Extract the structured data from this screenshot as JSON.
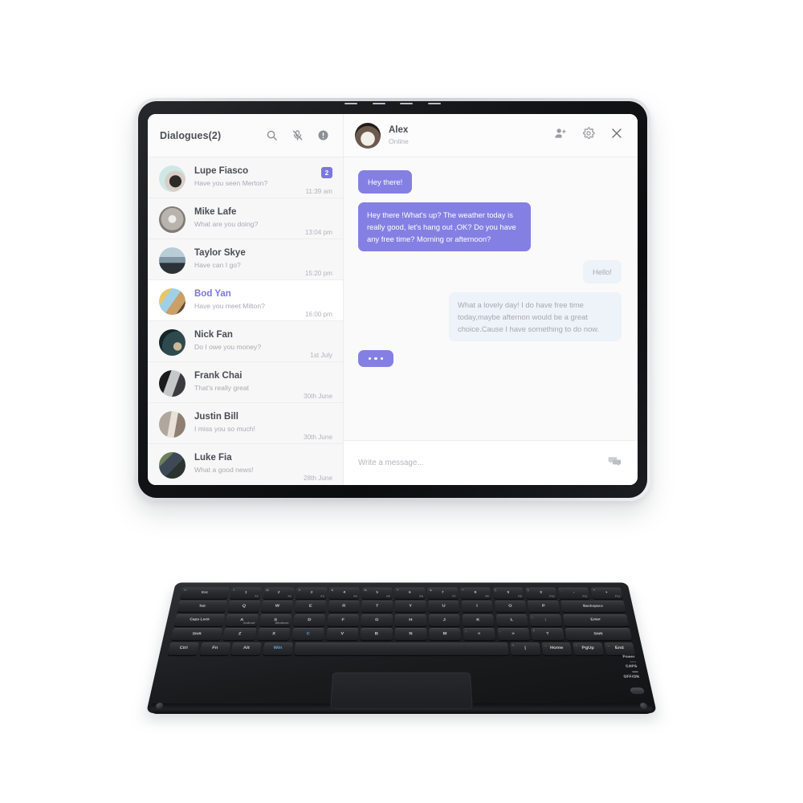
{
  "sidebar": {
    "title": "Dialogues(2)",
    "icons": [
      {
        "name": "search-icon",
        "label": "Search"
      },
      {
        "name": "microphone-muted-icon",
        "label": "Mute"
      },
      {
        "name": "info-icon",
        "label": "Info"
      }
    ],
    "conversations": [
      {
        "name": "Lupe Fiasco",
        "preview": "Have you seen Merton?",
        "time": "11:39  am",
        "badge": "2",
        "active": false
      },
      {
        "name": "Mike Lafe",
        "preview": "What are you doing?",
        "time": "13:04  pm",
        "badge": "",
        "active": false
      },
      {
        "name": "Taylor Skye",
        "preview": "Have can I go?",
        "time": "15:20  pm",
        "badge": "",
        "active": false
      },
      {
        "name": "Bod Yan",
        "preview": "Have you meet Milton?",
        "time": "16:00  pm",
        "badge": "",
        "active": true
      },
      {
        "name": "Nick Fan",
        "preview": "Do I owe you money?",
        "time": "1st  July",
        "badge": "",
        "active": false
      },
      {
        "name": "Frank Chai",
        "preview": "That's really great",
        "time": "30th June",
        "badge": "",
        "active": false
      },
      {
        "name": "Justin Bill",
        "preview": "I miss you so much!",
        "time": "30th June",
        "badge": "",
        "active": false
      },
      {
        "name": "Luke Fia",
        "preview": "What a good news!",
        "time": "28th  June",
        "badge": "",
        "active": false
      }
    ]
  },
  "chat": {
    "peer_name": "Alex",
    "peer_status": "Online",
    "header_icons": [
      {
        "name": "add-person-icon",
        "label": "Add person"
      },
      {
        "name": "gear-icon",
        "label": "Settings"
      },
      {
        "name": "close-icon",
        "label": "Close"
      }
    ],
    "messages": [
      {
        "direction": "in",
        "text": "Hey there!"
      },
      {
        "direction": "in",
        "text": "Hey there !What's up? The weather today is really good, let's hang out ,OK? Do you have any free time? Morning or afternoon?"
      },
      {
        "direction": "out",
        "text": "Hello!"
      },
      {
        "direction": "out",
        "text": "What a lovely day! I do have free time today,maybe afternon would be a great choice.Cause I have something to do now."
      },
      {
        "direction": "in",
        "text": "...",
        "typing": true
      }
    ],
    "composer": {
      "placeholder": "Write a message...",
      "value": "",
      "icon": "chat-bubbles-icon"
    }
  },
  "keyboard": {
    "rows": [
      [
        {
          "main": "Esc",
          "top": "↩",
          "sub": ""
        },
        {
          "main": "1",
          "top": "!",
          "sub": "F1"
        },
        {
          "main": "2",
          "top": "@",
          "sub": "F2"
        },
        {
          "main": "3",
          "top": "#",
          "sub": "F3"
        },
        {
          "main": "4",
          "top": "$",
          "sub": "F4"
        },
        {
          "main": "5",
          "top": "%",
          "sub": "F5"
        },
        {
          "main": "6",
          "top": "^",
          "sub": "F6"
        },
        {
          "main": "7",
          "top": "&",
          "sub": "F7"
        },
        {
          "main": "8",
          "top": "*",
          "sub": "F8"
        },
        {
          "main": "9",
          "top": "(",
          "sub": "F9"
        },
        {
          "main": "0",
          "top": ")",
          "sub": "F10"
        },
        {
          "main": "-",
          "top": "_",
          "sub": "F11"
        },
        {
          "main": "+",
          "top": "=",
          "sub": "F12"
        }
      ],
      [
        {
          "main": "Tab",
          "top": "",
          "sub": ""
        },
        {
          "main": "Q",
          "top": "",
          "sub": ""
        },
        {
          "main": "W",
          "top": "",
          "sub": ""
        },
        {
          "main": "E",
          "top": "",
          "sub": ""
        },
        {
          "main": "R",
          "top": "",
          "sub": ""
        },
        {
          "main": "T",
          "top": "",
          "sub": ""
        },
        {
          "main": "Y",
          "top": "",
          "sub": ""
        },
        {
          "main": "U",
          "top": "",
          "sub": ""
        },
        {
          "main": "I",
          "top": "",
          "sub": ""
        },
        {
          "main": "O",
          "top": "",
          "sub": ""
        },
        {
          "main": "P",
          "top": "",
          "sub": ""
        },
        {
          "main": "Backspace",
          "top": "",
          "sub": ""
        }
      ],
      [
        {
          "main": "Caps Lock",
          "top": "",
          "sub": ""
        },
        {
          "main": "A",
          "top": "",
          "sub": "Android"
        },
        {
          "main": "S",
          "top": "",
          "sub": "Windows"
        },
        {
          "main": "D",
          "top": "",
          "sub": ""
        },
        {
          "main": "F",
          "top": "",
          "sub": ""
        },
        {
          "main": "G",
          "top": "",
          "sub": ""
        },
        {
          "main": "H",
          "top": "",
          "sub": ""
        },
        {
          "main": "J",
          "top": "",
          "sub": ""
        },
        {
          "main": "K",
          "top": "",
          "sub": ""
        },
        {
          "main": "L",
          "top": "",
          "sub": ""
        },
        {
          "main": ":",
          "top": ";",
          "sub": ""
        },
        {
          "main": "Enter",
          "top": "",
          "sub": ""
        }
      ],
      [
        {
          "main": "Shift",
          "top": "",
          "sub": ""
        },
        {
          "main": "Z",
          "top": "",
          "sub": ""
        },
        {
          "main": "X",
          "top": "",
          "sub": ""
        },
        {
          "main": "C",
          "top": "",
          "sub": ""
        },
        {
          "main": "V",
          "top": "",
          "sub": ""
        },
        {
          "main": "B",
          "top": "",
          "sub": ""
        },
        {
          "main": "N",
          "top": "",
          "sub": ""
        },
        {
          "main": "M",
          "top": "",
          "sub": ""
        },
        {
          "main": "<",
          "top": ",",
          "sub": ""
        },
        {
          "main": ">",
          "top": ".",
          "sub": ""
        },
        {
          "main": "?",
          "top": "/",
          "sub": ""
        },
        {
          "main": "Shift",
          "top": "",
          "sub": ""
        }
      ],
      [
        {
          "main": "Ctrl",
          "top": "",
          "sub": ""
        },
        {
          "main": "Fn",
          "top": "",
          "sub": ""
        },
        {
          "main": "Alt",
          "top": "",
          "sub": ""
        },
        {
          "main": "Win",
          "top": "",
          "sub": ""
        },
        {
          "main": "",
          "top": "",
          "sub": ""
        },
        {
          "main": "|",
          "top": "\\",
          "sub": ""
        },
        {
          "main": "Home",
          "top": "←",
          "sub": ""
        },
        {
          "main": "PgUp",
          "top": "↑",
          "sub": ""
        },
        {
          "main": "End",
          "top": "→",
          "sub": ""
        }
      ]
    ],
    "indicators": [
      "Power",
      "CAPS",
      "OFF/ON"
    ]
  },
  "colors": {
    "accent_purple": "#8480e3",
    "active_name": "#7b77e0",
    "bubble_out_bg": "#eef2f9",
    "sidebar_bg": "#f7f7f8",
    "chat_bg": "#fafafa"
  }
}
